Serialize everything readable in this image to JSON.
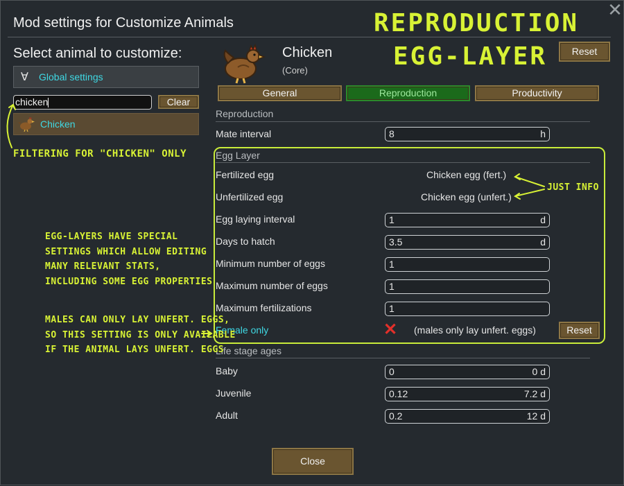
{
  "window": {
    "title": "Mod settings for Customize Animals",
    "close_label": "✕"
  },
  "sidebar": {
    "heading": "Select animal to customize:",
    "global_label": "Global settings",
    "global_icon": "∀",
    "search_value": "chicken",
    "clear_label": "Clear",
    "result_label": "Chicken"
  },
  "animal": {
    "name": "Chicken",
    "source": "(Core)",
    "reset_label": "Reset"
  },
  "tabs": [
    {
      "label": "General",
      "active": false
    },
    {
      "label": "Reproduction",
      "active": true
    },
    {
      "label": "Productivity",
      "active": false
    }
  ],
  "reproduction": {
    "heading": "Reproduction",
    "mate_interval_label": "Mate interval",
    "mate_interval_value": "8",
    "mate_interval_unit": "h"
  },
  "egg_layer": {
    "heading": "Egg Layer",
    "fertilized_label": "Fertilized egg",
    "fertilized_value": "Chicken egg (fert.)",
    "unfertilized_label": "Unfertilized egg",
    "unfertilized_value": "Chicken egg (unfert.)",
    "laying_interval_label": "Egg laying interval",
    "laying_interval_value": "1",
    "laying_interval_unit": "d",
    "days_to_hatch_label": "Days to hatch",
    "days_to_hatch_value": "3.5",
    "days_to_hatch_unit": "d",
    "min_eggs_label": "Minimum number of eggs",
    "min_eggs_value": "1",
    "max_eggs_label": "Maximum number of eggs",
    "max_eggs_value": "1",
    "max_fert_label": "Maximum fertilizations",
    "max_fert_value": "1",
    "female_only_label": "Female only",
    "female_only_mark": "✕",
    "female_only_note": "(males only lay unfert. eggs)",
    "reset_label": "Reset"
  },
  "life_stages": {
    "heading": "Life stage ages",
    "rows": [
      {
        "label": "Baby",
        "value": "0",
        "days": "0 d"
      },
      {
        "label": "Juvenile",
        "value": "0.12",
        "days": "7.2 d"
      },
      {
        "label": "Adult",
        "value": "0.2",
        "days": "12 d"
      }
    ]
  },
  "footer": {
    "close_label": "Close"
  },
  "annotations": {
    "headline_1": "Reproduction",
    "headline_2": "egg-layer",
    "filter_note": "Filtering for \"chicken\" only",
    "just_info": "Just info",
    "egg_note_lines": [
      "Egg-layers have special",
      "settings which allow editing",
      "many relevant stats,",
      "including some egg properties"
    ],
    "males_note_lines": [
      "Males can only lay unfert. eggs,",
      "so this setting is only available",
      "if the animal lays unfert. eggs"
    ]
  },
  "colors": {
    "accent_cyan": "#3fd8e3",
    "annotation_lime": "#d8f235",
    "tab_active": "#1b6a1b",
    "button_brown": "#6a5530"
  }
}
